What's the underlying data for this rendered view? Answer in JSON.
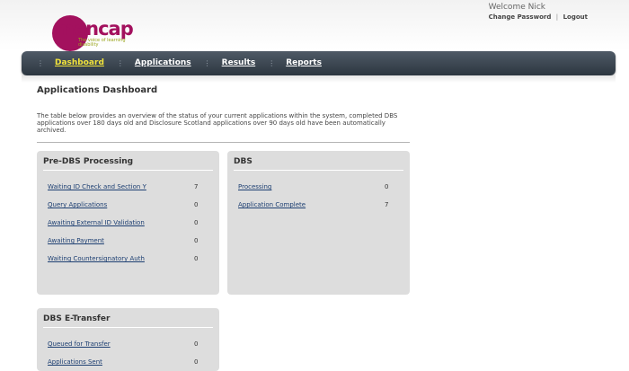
{
  "logo": {
    "brand": "mencap",
    "tagline": "The voice of learning disability"
  },
  "user": {
    "welcome": "Welcome Nick",
    "change_password": "Change Password",
    "separator": "|",
    "logout": "Logout"
  },
  "nav": {
    "items": [
      {
        "label": "Dashboard",
        "active": true
      },
      {
        "label": "Applications",
        "active": false
      },
      {
        "label": "Results",
        "active": false
      },
      {
        "label": "Reports",
        "active": false
      }
    ],
    "active_color": "#f3e43b"
  },
  "page": {
    "title": "Applications Dashboard",
    "intro": "The table below provides an overview of the status of your current applications within the system, completed DBS applications over 180 days old and Disclosure Scotland applications over 90 days old have been automatically archived."
  },
  "panels": {
    "pre_dbs": {
      "title": "Pre-DBS Processing",
      "rows": [
        {
          "label": "Waiting ID Check and Section Y",
          "count": "7"
        },
        {
          "label": "Query Applications",
          "count": "0"
        },
        {
          "label": "Awaiting External ID Validation",
          "count": "0"
        },
        {
          "label": "Awaiting Payment",
          "count": "0"
        },
        {
          "label": "Waiting Countersignatory Auth",
          "count": "0"
        }
      ]
    },
    "dbs": {
      "title": "DBS",
      "rows": [
        {
          "label": "Processing",
          "count": "0"
        },
        {
          "label": "Application Complete",
          "count": "7"
        }
      ]
    },
    "etransfer": {
      "title": "DBS E-Transfer",
      "rows": [
        {
          "label": "Queued for Transfer",
          "count": "0"
        },
        {
          "label": "Applications Sent",
          "count": "0"
        }
      ]
    }
  }
}
